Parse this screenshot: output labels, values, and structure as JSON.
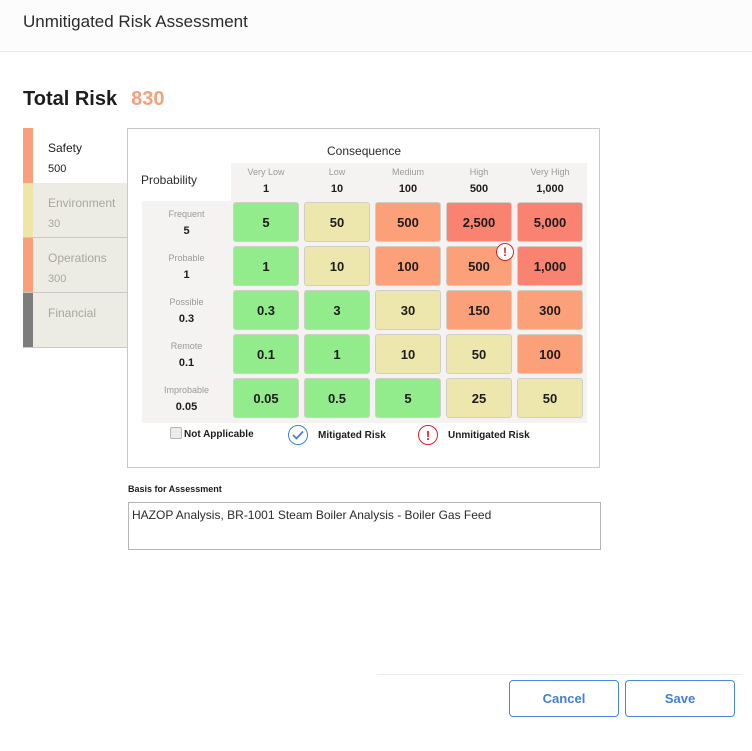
{
  "header": {
    "title": "Unmitigated Risk Assessment"
  },
  "total_risk": {
    "label": "Total Risk",
    "value": "830",
    "color": "#f7a07c"
  },
  "tabs": [
    {
      "name": "Safety",
      "value": "500",
      "color": "#f9a07a",
      "active": true
    },
    {
      "name": "Environment",
      "value": "30",
      "color": "#ede6a8",
      "active": false
    },
    {
      "name": "Operations",
      "value": "300",
      "color": "#f9a07a",
      "active": false
    },
    {
      "name": "Financial",
      "value": "",
      "color": "#7d7d7d",
      "active": false
    }
  ],
  "matrix": {
    "consequence_title": "Consequence",
    "probability_title": "Probability",
    "columns": [
      {
        "name": "Very Low",
        "value": "1"
      },
      {
        "name": "Low",
        "value": "10"
      },
      {
        "name": "Medium",
        "value": "100"
      },
      {
        "name": "High",
        "value": "500"
      },
      {
        "name": "Very High",
        "value": "1,000"
      }
    ],
    "rows": [
      {
        "name": "Frequent",
        "value": "5",
        "cells": [
          {
            "value": "5",
            "level": "green"
          },
          {
            "value": "50",
            "level": "yellow"
          },
          {
            "value": "500",
            "level": "orange"
          },
          {
            "value": "2,500",
            "level": "red"
          },
          {
            "value": "5,000",
            "level": "red"
          }
        ]
      },
      {
        "name": "Probable",
        "value": "1",
        "cells": [
          {
            "value": "1",
            "level": "green"
          },
          {
            "value": "10",
            "level": "yellow"
          },
          {
            "value": "100",
            "level": "orange"
          },
          {
            "value": "500",
            "level": "orange",
            "unmitigated": true
          },
          {
            "value": "1,000",
            "level": "red"
          }
        ]
      },
      {
        "name": "Possible",
        "value": "0.3",
        "cells": [
          {
            "value": "0.3",
            "level": "green"
          },
          {
            "value": "3",
            "level": "green"
          },
          {
            "value": "30",
            "level": "yellow"
          },
          {
            "value": "150",
            "level": "orange"
          },
          {
            "value": "300",
            "level": "orange"
          }
        ]
      },
      {
        "name": "Remote",
        "value": "0.1",
        "cells": [
          {
            "value": "0.1",
            "level": "green"
          },
          {
            "value": "1",
            "level": "green"
          },
          {
            "value": "10",
            "level": "yellow"
          },
          {
            "value": "50",
            "level": "yellow"
          },
          {
            "value": "100",
            "level": "orange"
          }
        ]
      },
      {
        "name": "Improbable",
        "value": "0.05",
        "cells": [
          {
            "value": "0.05",
            "level": "green"
          },
          {
            "value": "0.5",
            "level": "green"
          },
          {
            "value": "5",
            "level": "green"
          },
          {
            "value": "25",
            "level": "yellow"
          },
          {
            "value": "50",
            "level": "yellow"
          }
        ]
      }
    ],
    "level_colors": {
      "green": "#92ec8c",
      "yellow": "#ede6ad",
      "orange": "#fca079",
      "red": "#f98270"
    }
  },
  "legend": {
    "not_applicable": "Not Applicable",
    "mitigated": "Mitigated Risk",
    "unmitigated": "Unmitigated Risk",
    "not_applicable_checked": false
  },
  "basis": {
    "label": "Basis for Assessment",
    "value": "HAZOP Analysis, BR-1001 Steam Boiler Analysis - Boiler Gas Feed"
  },
  "footer": {
    "cancel_label": "Cancel",
    "save_label": "Save"
  }
}
